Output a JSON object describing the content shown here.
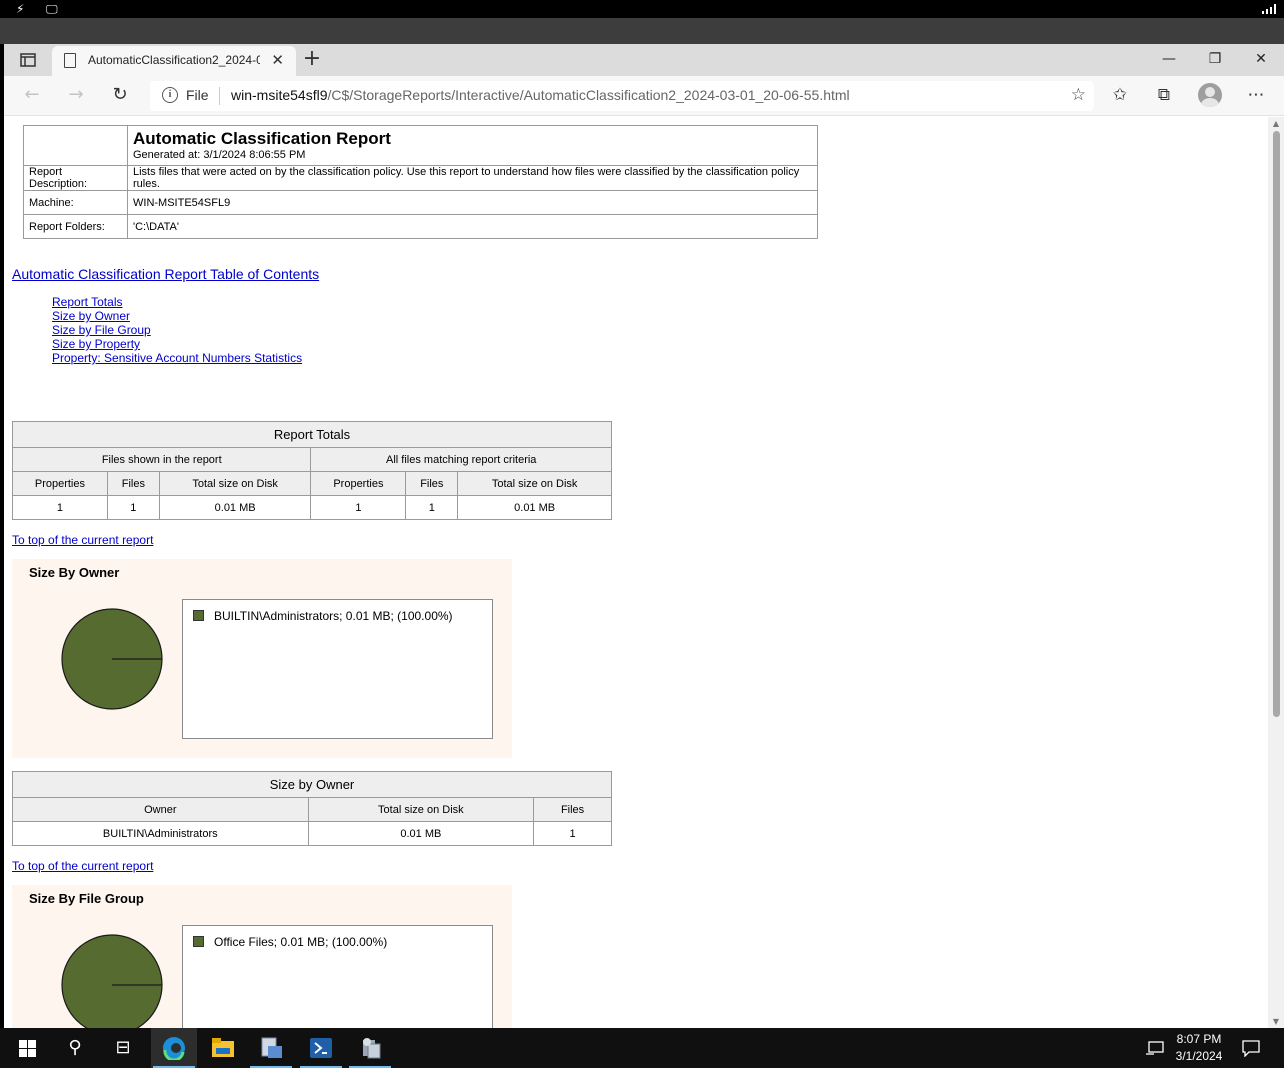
{
  "browser": {
    "tab_title": "AutomaticClassification2_2024-03-01_20-06-55.html",
    "url_scheme": "File",
    "url_host": "win-msite54sfl9",
    "url_path": "/C$/StorageReports/Interactive/AutomaticClassification2_2024-03-01_20-06-55.html"
  },
  "report": {
    "title": "Automatic Classification Report",
    "generated": "Generated at: 3/1/2024 8:06:55 PM",
    "rows": [
      {
        "label": "Report Description:",
        "value": "Lists files that were acted on by the classification policy. Use this report to understand how files were classified by the classification policy rules."
      },
      {
        "label": "Machine:",
        "value": "WIN-MSITE54SFL9"
      },
      {
        "label": "Report Folders:",
        "value": "'C:\\DATA'"
      }
    ]
  },
  "toc": {
    "title": "Automatic Classification Report Table of Contents",
    "items": [
      "Report Totals",
      "Size by Owner",
      "Size by File Group",
      "Size by Property",
      "Property: Sensitive Account Numbers Statistics"
    ]
  },
  "totals": {
    "caption": "Report Totals",
    "group1": "Files shown in the report",
    "group2": "All files matching report criteria",
    "headers": [
      "Properties",
      "Files",
      "Total size on Disk",
      "Properties",
      "Files",
      "Total size on Disk"
    ],
    "values": [
      "1",
      "1",
      "0.01 MB",
      "1",
      "1",
      "0.01 MB"
    ]
  },
  "to_top": "To top of the current report",
  "owner_chart": {
    "title": "Size By Owner",
    "legend": "BUILTIN\\Administrators; 0.01 MB; (100.00%)",
    "color": "#556b2f"
  },
  "owner_table": {
    "caption": "Size by Owner",
    "headers": [
      "Owner",
      "Total size on Disk",
      "Files"
    ],
    "row": [
      "BUILTIN\\Administrators",
      "0.01 MB",
      "1"
    ]
  },
  "filegroup_chart": {
    "title": "Size By File Group",
    "legend": "Office Files; 0.01 MB; (100.00%)",
    "color": "#556b2f"
  },
  "chart_data": [
    {
      "type": "pie",
      "title": "Size By Owner",
      "labels": [
        "BUILTIN\\Administrators"
      ],
      "values": [
        100.0
      ],
      "legend": "right"
    },
    {
      "type": "pie",
      "title": "Size By File Group",
      "labels": [
        "Office Files"
      ],
      "values": [
        100.0
      ],
      "legend": "right"
    }
  ],
  "clock": {
    "time": "8:07 PM",
    "date": "3/1/2024"
  }
}
